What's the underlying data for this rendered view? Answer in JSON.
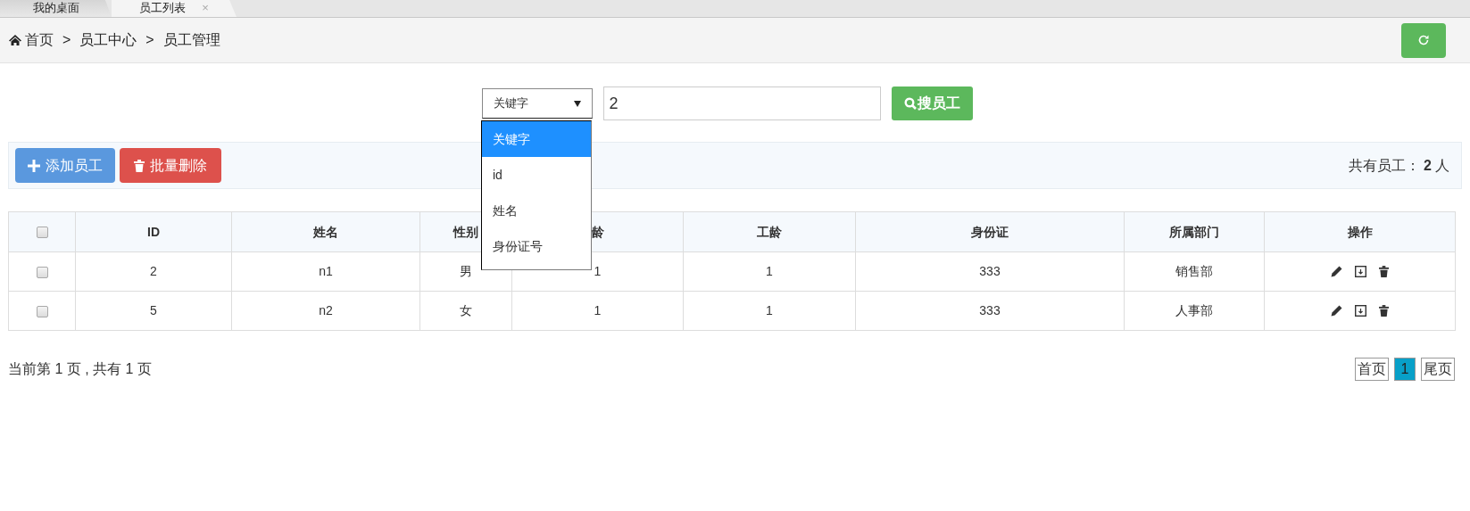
{
  "tabs": [
    {
      "label": "我的桌面",
      "selected": false
    },
    {
      "label": "员工列表",
      "selected": true,
      "close_glyph": "×"
    }
  ],
  "breadcrumb": [
    "首页",
    "员工中心",
    "员工管理"
  ],
  "breadcrumb_separator": ">",
  "search": {
    "field_select": {
      "value": "关键字",
      "expanded": true,
      "options": [
        {
          "label": "关键字",
          "selected": true
        },
        {
          "label": "id",
          "selected": false
        },
        {
          "label": "姓名",
          "selected": false
        },
        {
          "label": "身份证号",
          "selected": false
        }
      ]
    },
    "query": "2",
    "button": "搜员工"
  },
  "toolbar": {
    "add_button": "添加员工",
    "delete_button": "批量删除",
    "count_prefix": "共有员工：",
    "count": "2",
    "count_suffix": "人"
  },
  "table": {
    "select_all_checked": false,
    "columns": [
      "ID",
      "姓名",
      "性别",
      "龄",
      "工龄",
      "身份证",
      "所属部门",
      "操作"
    ],
    "rows": [
      {
        "checked": false,
        "cells": [
          "2",
          "n1",
          "男",
          "1",
          "1",
          "333",
          "销售部"
        ]
      },
      {
        "checked": false,
        "cells": [
          "5",
          "n2",
          "女",
          "1",
          "1",
          "333",
          "人事部"
        ]
      }
    ]
  },
  "pagination": {
    "summary": "当前第 1 页 , 共有 1 页",
    "first": "首页",
    "pages": [
      {
        "label": "1",
        "selected": true
      }
    ],
    "last": "尾页"
  }
}
